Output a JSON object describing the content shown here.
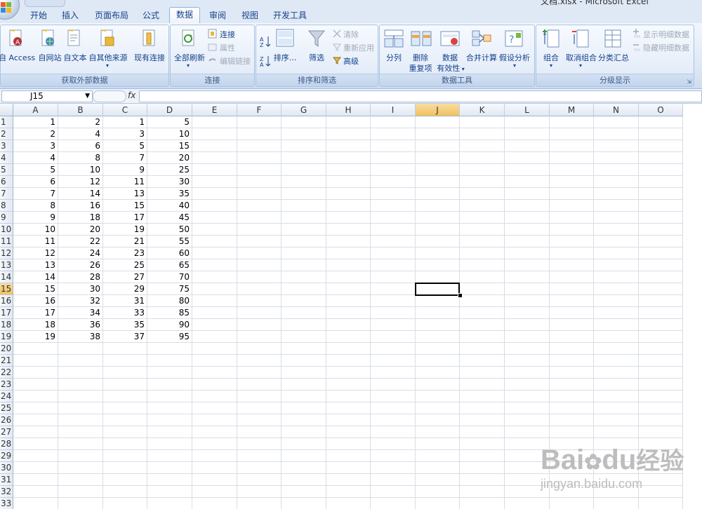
{
  "window": {
    "title": "文档.xlsx - Microsoft Excel"
  },
  "tabs": [
    {
      "label": "开始"
    },
    {
      "label": "插入"
    },
    {
      "label": "页面布局"
    },
    {
      "label": "公式"
    },
    {
      "label": "数据",
      "active": true
    },
    {
      "label": "审阅"
    },
    {
      "label": "视图"
    },
    {
      "label": "开发工具"
    }
  ],
  "ribbon": {
    "external": {
      "label": "获取外部数据",
      "access": "自 Access",
      "web": "自网站",
      "text": "自文本",
      "other": "自其他来源",
      "existing": "现有连接"
    },
    "connections": {
      "label": "连接",
      "refresh_all": "全部刷新",
      "connections": "连接",
      "properties": "属性",
      "edit_links": "编辑链接"
    },
    "sort_filter": {
      "label": "排序和筛选",
      "sort": "排序...",
      "filter": "筛选",
      "clear": "清除",
      "reapply": "重新应用",
      "advanced": "高级"
    },
    "data_tools": {
      "label": "数据工具",
      "text_to_columns": "分列",
      "remove_dup_1": "删除",
      "remove_dup_2": "重复项",
      "validation_1": "数据",
      "validation_2": "有效性",
      "consolidate": "合并计算",
      "whatif": "假设分析"
    },
    "outline": {
      "label": "分级显示",
      "group": "组合",
      "ungroup": "取消组合",
      "subtotal": "分类汇总",
      "show_detail": "显示明细数据",
      "hide_detail": "隐藏明细数据"
    }
  },
  "formula_bar": {
    "name_box": "J15",
    "fx": "fx",
    "value": ""
  },
  "sheet": {
    "columns": [
      "A",
      "B",
      "C",
      "D",
      "E",
      "F",
      "G",
      "H",
      "I",
      "J",
      "K",
      "L",
      "M",
      "N",
      "O"
    ],
    "selected_column": "J",
    "selected_row": 15,
    "rows": [
      [
        1,
        2,
        1,
        5
      ],
      [
        2,
        4,
        3,
        10
      ],
      [
        3,
        6,
        5,
        15
      ],
      [
        4,
        8,
        7,
        20
      ],
      [
        5,
        10,
        9,
        25
      ],
      [
        6,
        12,
        11,
        30
      ],
      [
        7,
        14,
        13,
        35
      ],
      [
        8,
        16,
        15,
        40
      ],
      [
        9,
        18,
        17,
        45
      ],
      [
        10,
        20,
        19,
        50
      ],
      [
        11,
        22,
        21,
        55
      ],
      [
        12,
        24,
        23,
        60
      ],
      [
        13,
        26,
        25,
        65
      ],
      [
        14,
        28,
        27,
        70
      ],
      [
        15,
        30,
        29,
        75
      ],
      [
        16,
        32,
        31,
        80
      ],
      [
        17,
        34,
        33,
        85
      ],
      [
        18,
        36,
        35,
        90
      ],
      [
        19,
        38,
        37,
        95
      ]
    ],
    "row_count": 33
  },
  "watermark": {
    "brand": "Bai",
    "brand2": "du",
    "brand_cn": "经验",
    "url": "jingyan.baidu.com"
  }
}
